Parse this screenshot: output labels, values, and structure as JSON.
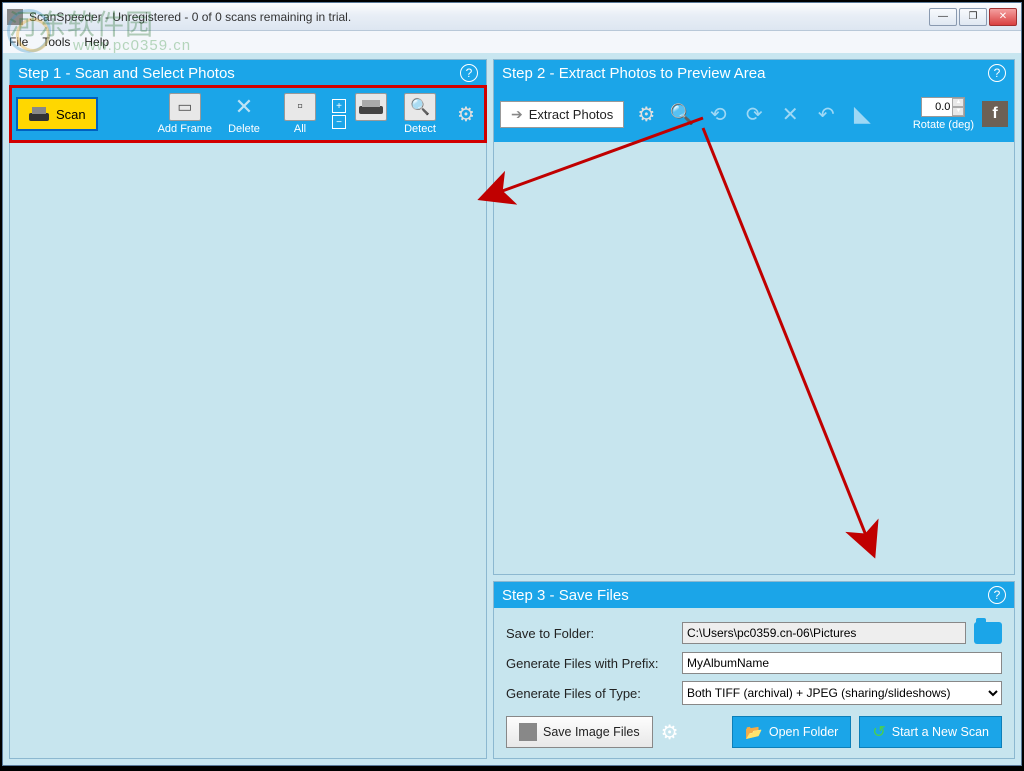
{
  "title": "ScanSpeeder - Unregistered - 0 of 0 scans remaining in trial.",
  "menu": {
    "file": "File",
    "tools": "Tools",
    "help": "Help"
  },
  "step1": {
    "title": "Step 1 - Scan and Select Photos",
    "scan": "Scan",
    "addframe": "Add Frame",
    "delete": "Delete",
    "all": "All",
    "detect": "Detect"
  },
  "step2": {
    "title": "Step 2 - Extract Photos to Preview Area",
    "extract": "Extract Photos",
    "rotate_label": "Rotate (deg)",
    "rotate_value": "0.0"
  },
  "step3": {
    "title": "Step 3 - Save Files",
    "save_to_folder": "Save to Folder:",
    "folder_value": "C:\\Users\\pc0359.cn-06\\Pictures",
    "prefix_label": "Generate Files with Prefix:",
    "prefix_value": "MyAlbumName",
    "type_label": "Generate Files of Type:",
    "type_value": "Both TIFF (archival) + JPEG (sharing/slideshows)",
    "save_btn": "Save Image Files",
    "open_folder": "Open Folder",
    "new_scan": "Start a New Scan"
  },
  "watermark": {
    "text": "河东软件园",
    "url": "www.pc0359.cn"
  }
}
